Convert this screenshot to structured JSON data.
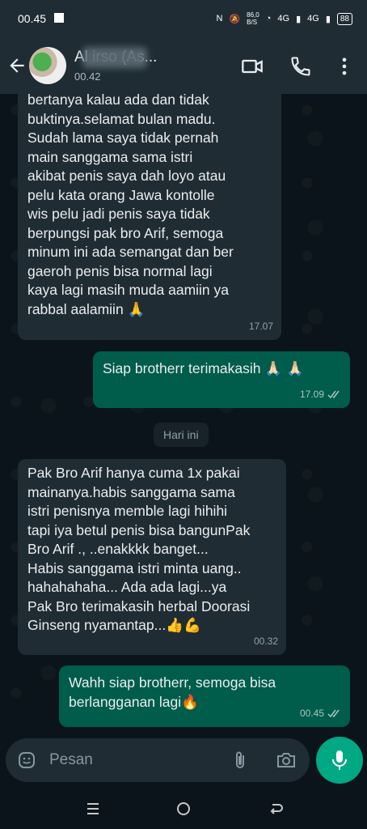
{
  "status_bar": {
    "time": "00.45",
    "speed": "86,0\nB/S",
    "net1": "4G",
    "net2": "4G",
    "battery": "88"
  },
  "header": {
    "chat_name": "Al            irso (As...",
    "last_seen": "00.42",
    "icons": [
      "back-arrow-icon",
      "video-call-icon",
      "phone-icon",
      "more-vertical-icon"
    ]
  },
  "messages": [
    {
      "direction": "incoming",
      "text": "bertanya kalau ada dan tidak\nbuktinya.selamat bulan madu.\nSudah lama  saya tidak pernah\nmain sanggama sama istri\nakibat penis saya dah loyo atau\npelu kata orang Jawa kontolle\nwis pelu jadi penis saya tidak\nberpungsi pak bro Arif, semoga\nminum ini ada semangat dan ber\ngaeroh penis bisa normal lagi\nkaya lagi masih muda aamiin ya\nrabbal aalamiin 🙏",
      "time": "17.07"
    },
    {
      "direction": "outgoing",
      "text": "Siap brotherr terimakasih 🙏🏻 🙏🏻",
      "time": "17.09"
    },
    {
      "direction": "incoming",
      "text": "Pak Bro Arif hanya cuma 1x pakai\nmainanya.habis sanggama sama\nistri penisnya memble lagi hihihi\ntapi iya betul penis bisa bangunPak\nBro Arif ., ..enakkkk banget...\nHabis sanggama istri minta uang..\nhahahahaha... Ada ada lagi...ya\nPak Bro terimakasih herbal Doorasi\nGinseng nyamantap...👍💪",
      "time": "00.32"
    },
    {
      "direction": "outgoing",
      "text": "Wahh siap brotherr, semoga bisa\nberlangganan lagi🔥",
      "time": "00.45"
    }
  ],
  "date_divider": "Hari ini",
  "composer": {
    "placeholder": "Pesan",
    "icons": [
      "emoji-icon",
      "attach-icon",
      "camera-icon",
      "mic-icon"
    ]
  },
  "colors": {
    "background": "#0b141a",
    "header": "#1f2c34",
    "incoming_bubble": "#202c33",
    "outgoing_bubble": "#005c4b",
    "accent": "#00a884"
  }
}
